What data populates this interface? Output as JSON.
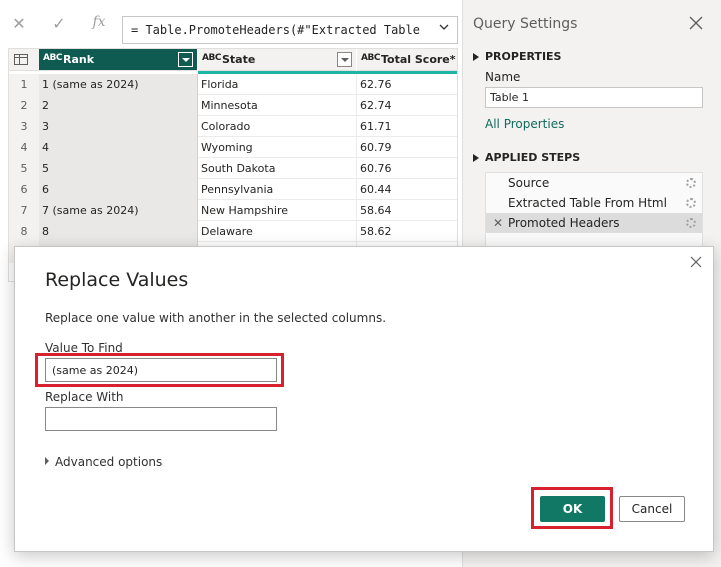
{
  "formula_bar": {
    "cancel_icon": "x-icon",
    "commit_icon": "check-icon",
    "fx_label": "fx",
    "formula": "= Table.PromoteHeaders(#\"Extracted Table"
  },
  "grid": {
    "columns": [
      {
        "type_label": "ABC",
        "name": "Rank"
      },
      {
        "type_label": "ABC",
        "name": "State"
      },
      {
        "type_label": "ABC",
        "name": "Total Score*"
      }
    ],
    "rows": [
      {
        "num": "1",
        "rank": "1 (same as 2024)",
        "state": "Florida",
        "score": "62.76"
      },
      {
        "num": "2",
        "rank": "2",
        "state": "Minnesota",
        "score": "62.74"
      },
      {
        "num": "3",
        "rank": "3",
        "state": "Colorado",
        "score": "61.71"
      },
      {
        "num": "4",
        "rank": "4",
        "state": "Wyoming",
        "score": "60.79"
      },
      {
        "num": "5",
        "rank": "5",
        "state": "South Dakota",
        "score": "60.76"
      },
      {
        "num": "6",
        "rank": "6",
        "state": "Pennsylvania",
        "score": "60.44"
      },
      {
        "num": "7",
        "rank": "7 (same as 2024)",
        "state": "New Hampshire",
        "score": "58.64"
      },
      {
        "num": "8",
        "rank": "8",
        "state": "Delaware",
        "score": "58.62"
      }
    ]
  },
  "query_settings": {
    "title": "Query Settings",
    "properties_header": "PROPERTIES",
    "name_label": "Name",
    "name_value": "Table 1",
    "all_properties_link": "All Properties",
    "applied_steps_header": "APPLIED STEPS",
    "steps": [
      {
        "label": "Source"
      },
      {
        "label": "Extracted Table From Html"
      },
      {
        "label": "Promoted Headers"
      }
    ]
  },
  "dialog": {
    "title": "Replace Values",
    "description": "Replace one value with another in the selected columns.",
    "value_to_find_label": "Value To Find",
    "value_to_find": "(same as 2024)",
    "replace_with_label": "Replace With",
    "replace_with": "",
    "advanced_options": "Advanced options",
    "ok_label": "OK",
    "cancel_label": "Cancel"
  },
  "colors": {
    "accent": "#117865",
    "header_selected": "#0f5b52",
    "highlight": "#d6212e"
  }
}
